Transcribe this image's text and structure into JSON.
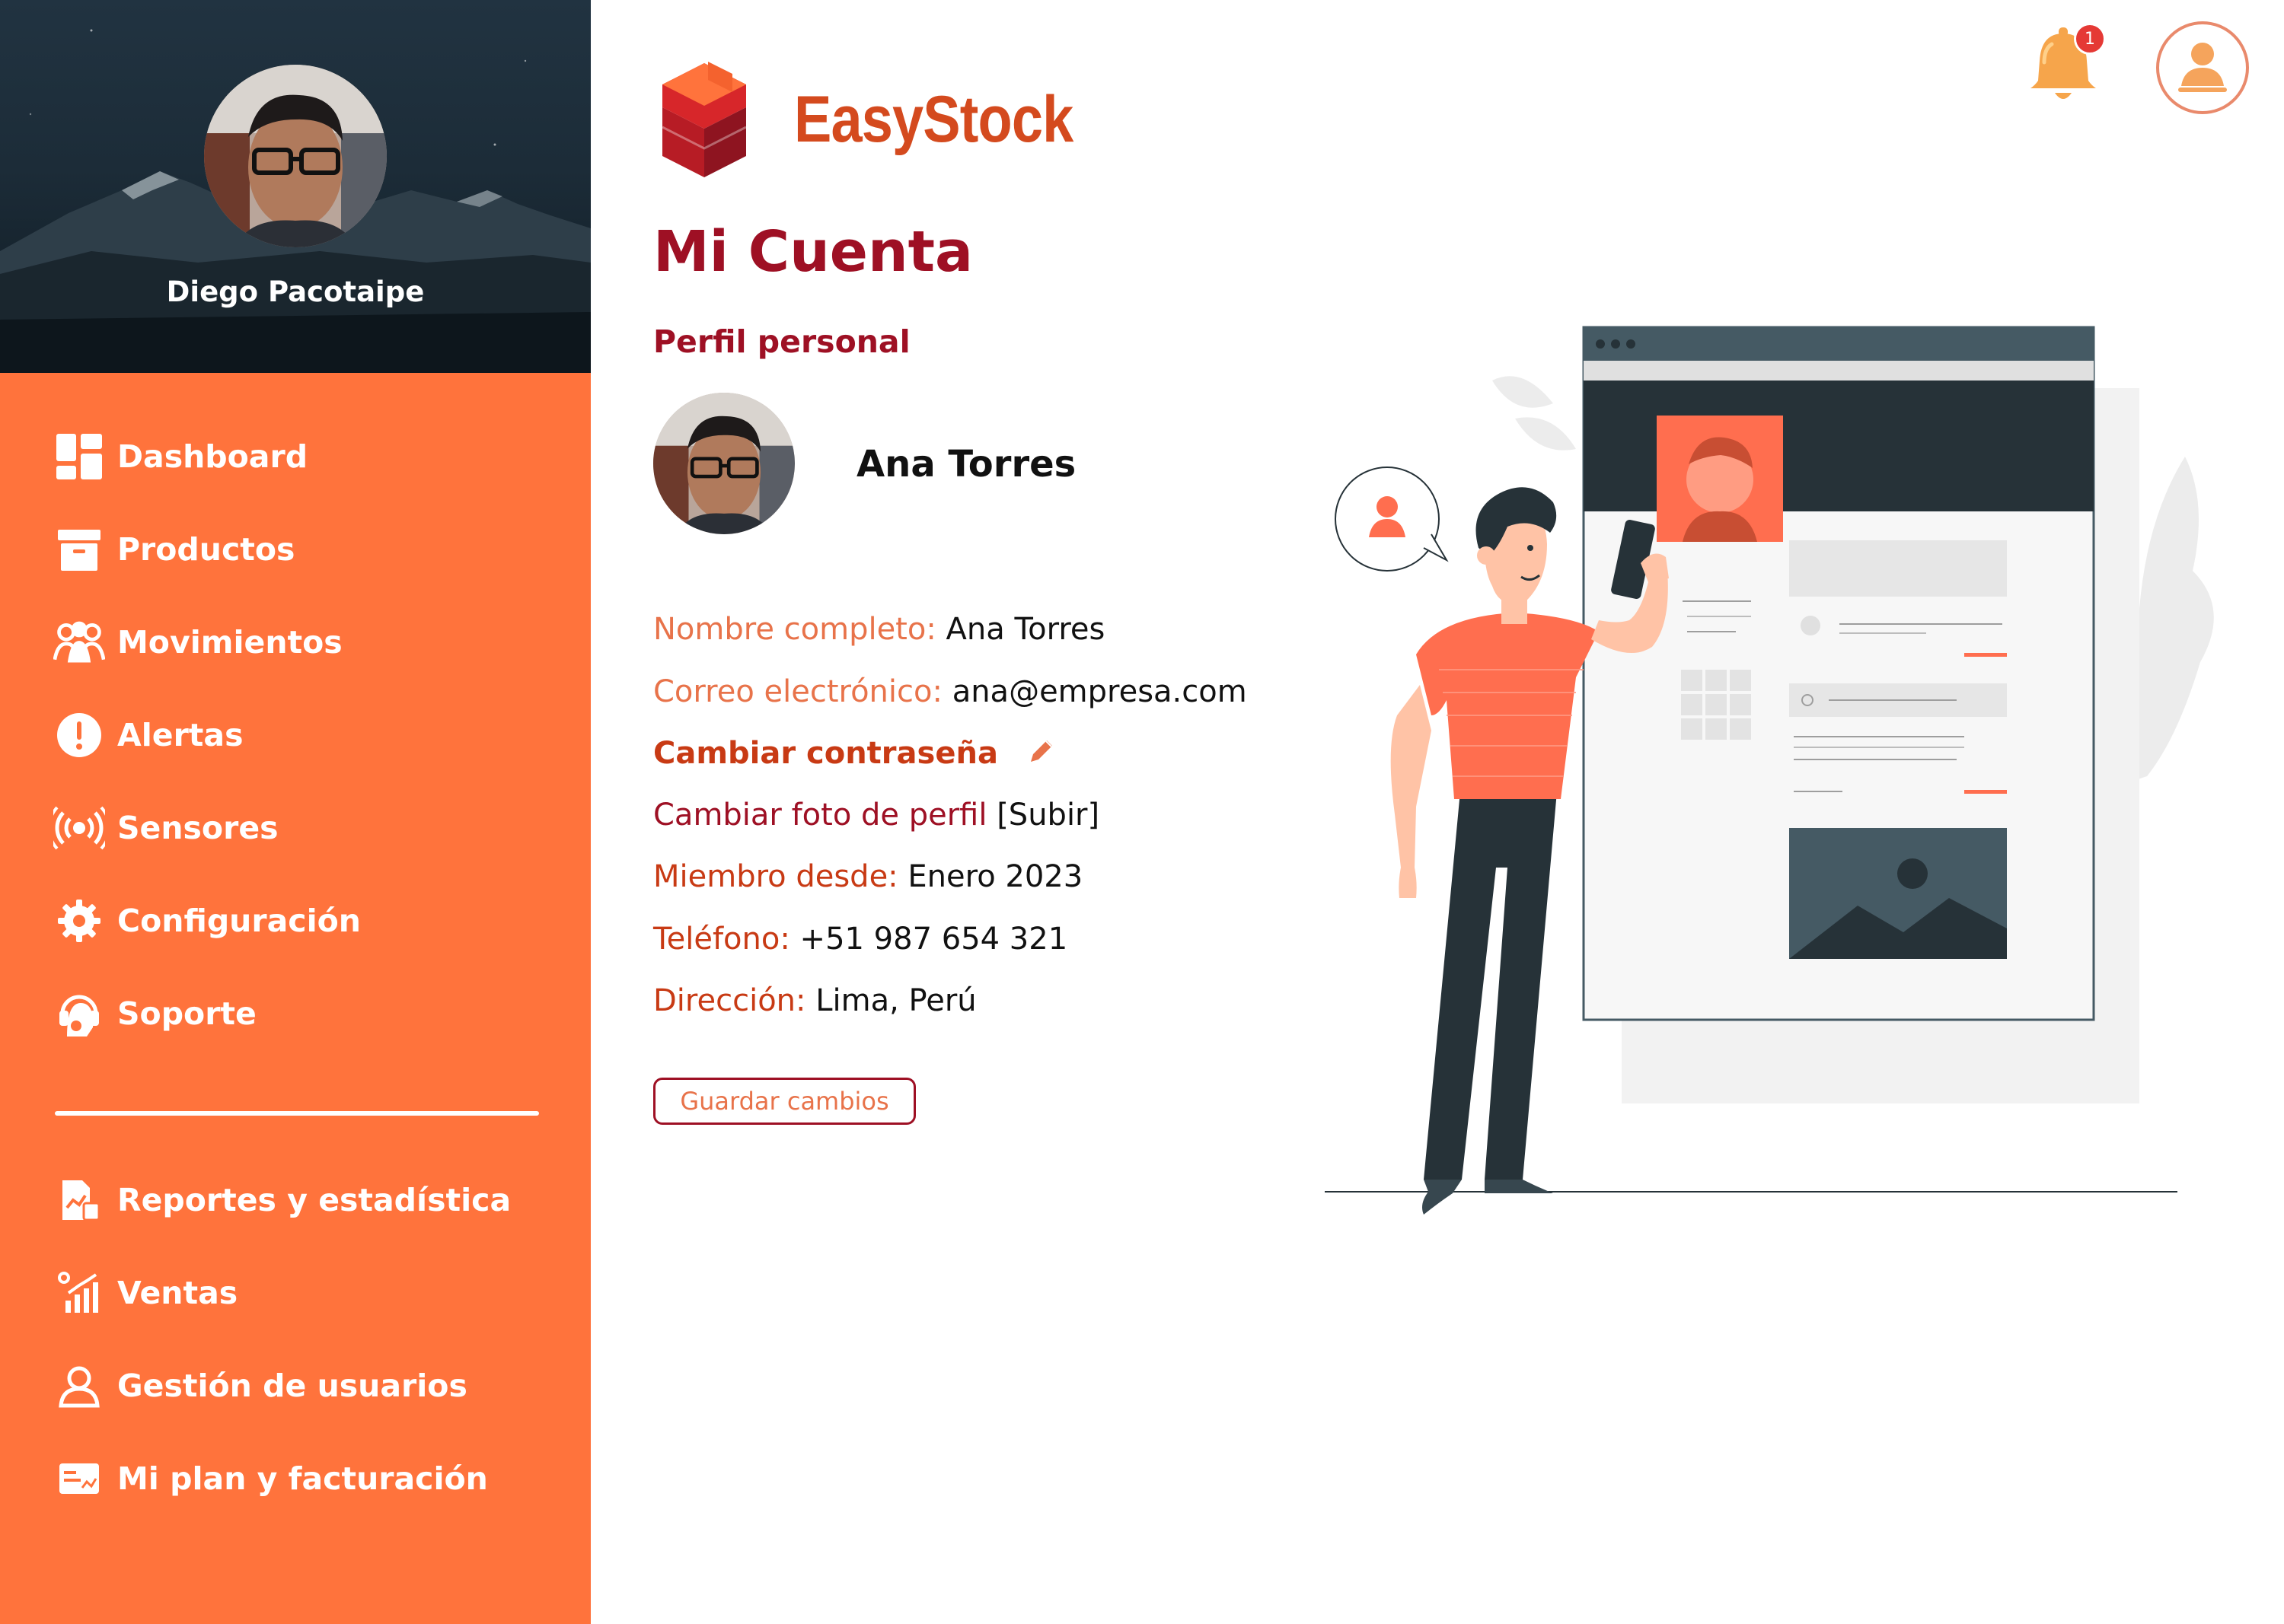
{
  "sidebar": {
    "user_name": "Diego Pacotaipe",
    "items": [
      {
        "label": "Dashboard",
        "icon": "dashboard-icon"
      },
      {
        "label": "Productos",
        "icon": "box-icon"
      },
      {
        "label": "Movimientos",
        "icon": "users-group-icon"
      },
      {
        "label": "Alertas",
        "icon": "alert-icon"
      },
      {
        "label": "Sensores",
        "icon": "sensor-icon"
      },
      {
        "label": "Configuración",
        "icon": "gear-icon"
      },
      {
        "label": "Soporte",
        "icon": "support-icon"
      }
    ],
    "secondary_items": [
      {
        "label": "Reportes y estadística",
        "icon": "report-icon"
      },
      {
        "label": "Ventas",
        "icon": "sales-icon"
      },
      {
        "label": "Gestión de usuarios",
        "icon": "user-management-icon"
      },
      {
        "label": "Mi plan y facturación",
        "icon": "billing-icon"
      }
    ]
  },
  "header": {
    "brand": "EasyStock",
    "notification_count": "1"
  },
  "main": {
    "title": "Mi Cuenta",
    "section": "Perfil personal",
    "profile_name": "Ana Torres",
    "fields": {
      "full_name_label": "Nombre completo:",
      "full_name_value": "Ana Torres",
      "email_label": "Correo electrónico:",
      "email_value": "ana@empresa.com",
      "change_password": "Cambiar contraseña",
      "change_photo": "Cambiar foto de perfil",
      "upload": "[Subir]",
      "member_since_label": "Miembro desde:",
      "member_since_value": "Enero 2023",
      "phone_label": "Teléfono:",
      "phone_value": "+51 987 654 321",
      "address_label": "Dirección:",
      "address_value": "Lima, Perú"
    },
    "save_button": "Guardar cambios"
  },
  "colors": {
    "sidebar": "#FF733C",
    "title": "#9E1024",
    "label": "#E8734A",
    "brand": "#D44A1E"
  }
}
